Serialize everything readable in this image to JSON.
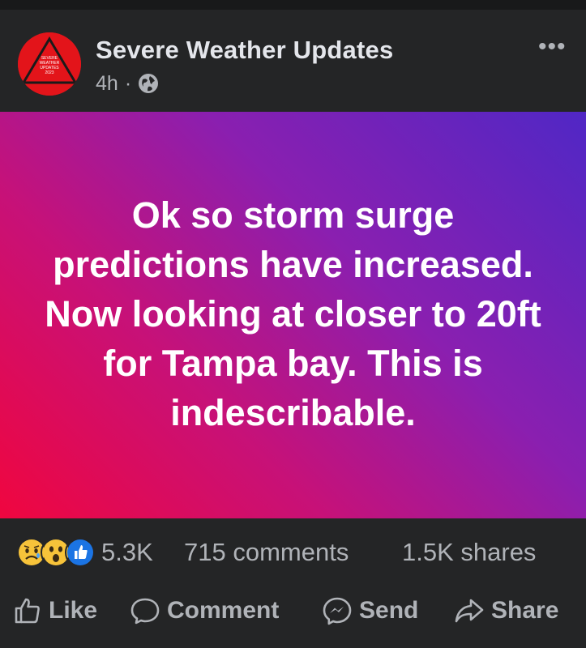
{
  "post": {
    "page_name": "Severe Weather Updates",
    "time": "4h",
    "separator": "·",
    "privacy_icon": "globe-icon",
    "more_label": "•••",
    "avatar_text": [
      "SEVERE",
      "WEATHER",
      "UPDATES",
      "2023"
    ],
    "body": "Ok so storm surge predictions have increased. Now looking at closer to 20ft for Tampa bay. This is indescribable.",
    "background_colors": [
      "#f0063f",
      "#c71178",
      "#8a1fb0",
      "#5027c5"
    ]
  },
  "stats": {
    "reactions": [
      "sad-icon",
      "wow-icon",
      "like-icon"
    ],
    "reaction_count": "5.3K",
    "comments": "715 comments",
    "shares": "1.5K shares"
  },
  "actions": {
    "like": "Like",
    "comment": "Comment",
    "send": "Send",
    "share": "Share"
  }
}
